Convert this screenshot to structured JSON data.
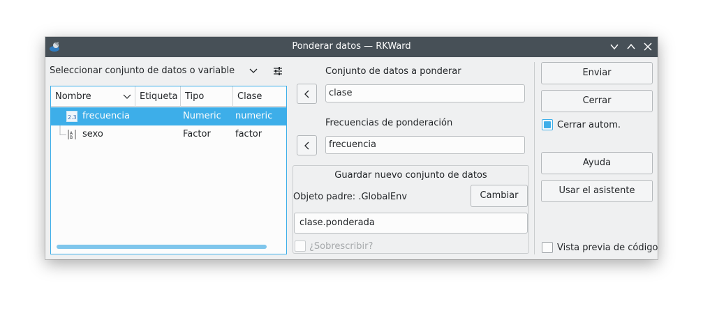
{
  "window": {
    "title": "Ponderar datos — RKWard"
  },
  "selector": {
    "label": "Seleccionar conjunto de datos o variable",
    "columns": [
      "Nombre",
      "Etiqueta",
      "Tipo",
      "Clase"
    ],
    "rows": [
      {
        "nombre": "frecuencia",
        "etiqueta": "",
        "tipo": "Numeric",
        "clase": "numeric",
        "icon": "numeric-variable-icon",
        "selected": true
      },
      {
        "nombre": "sexo",
        "etiqueta": "",
        "tipo": "Factor",
        "clase": "factor",
        "icon": "factor-variable-icon",
        "selected": false
      }
    ]
  },
  "dataset": {
    "label": "Conjunto de datos a ponderar",
    "value": "clase"
  },
  "weights": {
    "label": "Frecuencias de ponderación",
    "value": "frecuencia"
  },
  "save": {
    "title": "Guardar nuevo conjunto de datos",
    "parent_label": "Objeto padre: .GlobalEnv",
    "change_button": "Cambiar",
    "object_name": "clase.ponderada",
    "overwrite_label": "¿Sobrescribir?"
  },
  "actions": {
    "submit": "Enviar",
    "close": "Cerrar",
    "auto_close": "Cerrar autom.",
    "auto_close_checked": true,
    "help": "Ayuda",
    "wizard": "Usar el asistente",
    "preview": "Vista previa de código",
    "preview_checked": false
  }
}
